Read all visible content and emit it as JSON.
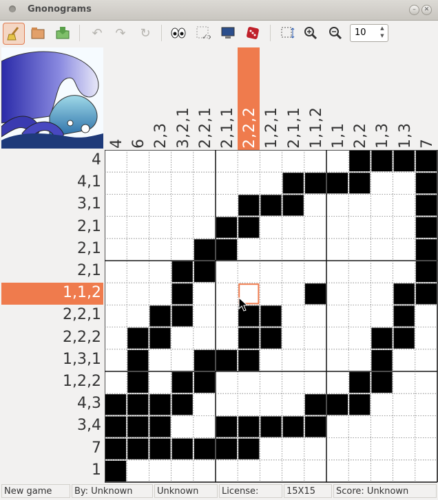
{
  "window": {
    "title": "Gnonograms"
  },
  "toolbar": {
    "icons": [
      "broom-icon",
      "open-folder-icon",
      "save-icon",
      "undo-icon",
      "redo-icon",
      "refresh-icon",
      "eyes-icon",
      "check-errors-icon",
      "computer-icon",
      "dice-icon",
      "resize-icon",
      "zoom-in-icon",
      "zoom-out-icon"
    ],
    "zoom_value": "10"
  },
  "puzzle": {
    "size": 15,
    "highlight_row": 6,
    "highlight_col": 6,
    "cursor": {
      "row": 6,
      "col": 6
    },
    "col_clues": [
      "4",
      "6",
      "2,3",
      "3,2,1",
      "2,2,1",
      "2,1,1",
      "2,2,2",
      "1,2,1",
      "2,1,1",
      "1,1,2",
      "1,1",
      "2,2",
      "1,3",
      "1,3",
      "7"
    ],
    "row_clues": [
      "4",
      "4,1",
      "3,1",
      "2,1",
      "2,1",
      "2,1",
      "1,1,2",
      "2,2,1",
      "2,2,2",
      "1,3,1",
      "1,2,2",
      "4,3",
      "3,4",
      "7",
      "1"
    ],
    "rows": [
      "...........####",
      "........####..#",
      "......###.....#",
      ".....##.......#",
      "....##........#",
      "...##.........#",
      "...#.....#...##",
      "..##..##.....#.",
      ".##...##....##.",
      ".#..###.....#..",
      ".#.##......##..",
      "####.....###...",
      "###..#####.....",
      "#######........",
      "#.............."
    ]
  },
  "colors": {
    "highlight": "#ef7b4d",
    "filled": "#000000",
    "empty": "#ffffff"
  },
  "status": {
    "game": "New game",
    "author": "By: Unknown",
    "date": "Unknown",
    "license": "License:",
    "size": "15X15",
    "score": "Score: Unknown"
  }
}
